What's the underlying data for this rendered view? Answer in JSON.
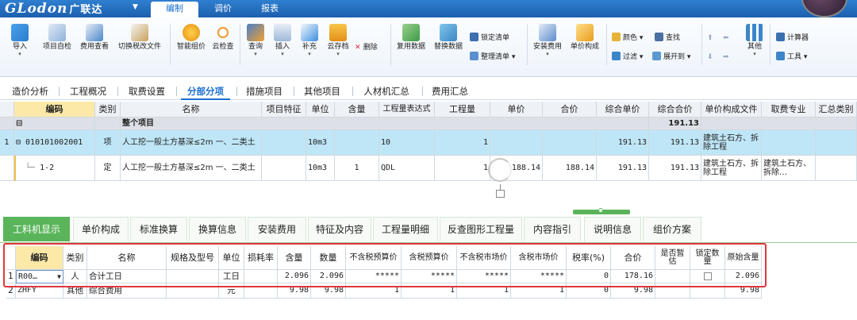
{
  "app": {
    "brand": "GLodon",
    "brand_cn": "广联达"
  },
  "top_tabs": [
    "编制",
    "调价",
    "报表"
  ],
  "ribbon": {
    "buttons": [
      "导入",
      "项目自检",
      "费用查看",
      "切换税改文件",
      "智能组价",
      "云检查",
      "查询",
      "插入",
      "补充",
      "云存档",
      "复用数据",
      "替换数据",
      "安装费用",
      "单价构成",
      "其他"
    ],
    "delete_label": "删除",
    "lock_list": "锁定清单",
    "organize_list": "整理清单",
    "color": "颜色",
    "find": "查找",
    "filter": "过滤",
    "expand": "展开到",
    "calculator": "计算器",
    "tools": "工具"
  },
  "sub_tabs": [
    "造价分析",
    "工程概况",
    "取费设置",
    "分部分项",
    "措施项目",
    "其他项目",
    "人材机汇总",
    "费用汇总"
  ],
  "main_grid": {
    "headers": [
      "编码",
      "类别",
      "名称",
      "项目特征",
      "单位",
      "含量",
      "工程量表达式",
      "工程量",
      "单价",
      "合价",
      "综合单价",
      "综合合价",
      "单价构成文件",
      "取费专业",
      "汇总类别"
    ],
    "group_row": {
      "toggle": "⊟",
      "name": "整个项目",
      "total": "191.13"
    },
    "rows": [
      {
        "idx": "1",
        "code": "⊟ 010101002001",
        "type": "项",
        "name": "人工挖一般土方基深≤2m 一、二类土",
        "feature": "",
        "unit": "10m3",
        "qty_ratio": "",
        "expr": "10",
        "qty": "1",
        "price": "",
        "amount": "",
        "unit_total": "191.13",
        "total": "191.13",
        "fee_file": "建筑土石方、拆除工程",
        "fee_major": ""
      },
      {
        "idx": "",
        "code": "1-2",
        "type": "定",
        "name": "人工挖一般土方基深≤2m 一、二类土",
        "feature": "",
        "unit": "10m3",
        "qty_ratio": "1",
        "expr": "QDL",
        "qty": "1",
        "price": "188.14",
        "amount": "188.14",
        "unit_total": "191.13",
        "total": "191.13",
        "fee_file": "建筑土石方、拆除工程",
        "fee_major": "建筑土石方、拆除…"
      }
    ]
  },
  "bottom_tabs": [
    "工料机显示",
    "单价构成",
    "标准换算",
    "换算信息",
    "安装费用",
    "特征及内容",
    "工程量明细",
    "反查图形工程量",
    "内容指引",
    "说明信息",
    "组价方案"
  ],
  "bottom_grid": {
    "headers": [
      "编码",
      "类别",
      "名称",
      "规格及型号",
      "单位",
      "损耗率",
      "含量",
      "数量",
      "不含税预算价",
      "含税预算价",
      "不含税市场价",
      "含税市场价",
      "税率(%)",
      "合价",
      "是否暂估",
      "锁定数量",
      "原始含量"
    ],
    "rows": [
      {
        "idx": "1",
        "code": "R00…",
        "type": "人",
        "name": "合计工日",
        "spec": "",
        "unit": "工日",
        "loss": "",
        "ratio": "2.096",
        "qty": "2.096",
        "p1": "*****",
        "p2": "*****",
        "p3": "*****",
        "p4": "*****",
        "tax": "0",
        "amount": "178.16",
        "orig": "2.096"
      },
      {
        "idx": "2",
        "code": "ZHFY",
        "type": "其他",
        "name": "综合费用",
        "spec": "",
        "unit": "元",
        "loss": "",
        "ratio": "9.98",
        "qty": "9.98",
        "p1": "1",
        "p2": "1",
        "p3": "1",
        "p4": "1",
        "tax": "0",
        "amount": "9.98",
        "orig": "9.98"
      }
    ]
  }
}
